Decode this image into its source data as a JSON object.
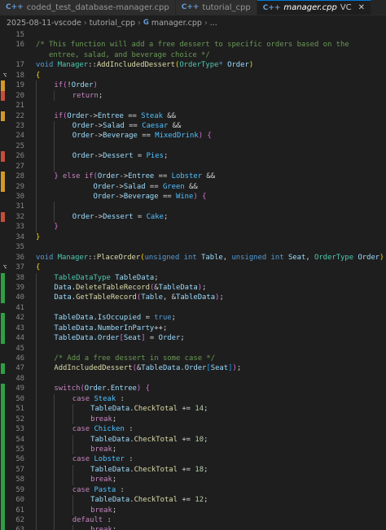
{
  "tabs": [
    {
      "label": "coded_test_database-manager.cpp",
      "icon": "C++",
      "active": false
    },
    {
      "label": "tutorial_cpp",
      "icon": "C++",
      "active": false
    },
    {
      "label": "manager.cpp",
      "icon": "C++",
      "active": true,
      "suffix": "VC"
    }
  ],
  "breadcrumb": [
    "2025-08-11-vscode",
    "tutorial_cpp",
    "manager.cpp",
    "..."
  ],
  "colors": {
    "added": "#2ea043",
    "modified": "#d19a2a",
    "deleted": "#c74e39"
  },
  "lines": [
    {
      "n": "15",
      "m": "",
      "t": [
        [
          "pl",
          ""
        ]
      ]
    },
    {
      "n": "16",
      "m": "",
      "t": [
        [
          "cm",
          "/* This function will add a free dessert to specific orders based on the"
        ]
      ]
    },
    {
      "n": "",
      "m": "",
      "t": [
        [
          "cm",
          "   entree, salad, and beverage choice */"
        ]
      ]
    },
    {
      "n": "17",
      "m": "",
      "t": [
        [
          "kw",
          "void "
        ],
        [
          "ty",
          "Manager"
        ],
        [
          "pl",
          "::"
        ],
        [
          "fn",
          "AddIncludedDessert"
        ],
        [
          "b1",
          "("
        ],
        [
          "ty",
          "OrderType"
        ],
        [
          "kw",
          "*"
        ],
        [
          "var",
          " Order"
        ],
        [
          "b1",
          ")"
        ]
      ]
    },
    {
      "n": "18",
      "m": "",
      "g": "ref",
      "t": [
        [
          "b1",
          "{"
        ]
      ]
    },
    {
      "n": "19",
      "m": "orange",
      "t": [
        [
          "i",
          ""
        ],
        [
          "ctl",
          "if"
        ],
        [
          "b2",
          "("
        ],
        [
          "pl",
          "!"
        ],
        [
          "var",
          "Order"
        ],
        [
          "b2",
          ")"
        ]
      ]
    },
    {
      "n": "20",
      "m": "red",
      "t": [
        [
          "i",
          ""
        ],
        [
          "i",
          ""
        ],
        [
          "ctl",
          "return"
        ],
        [
          "pl",
          ";"
        ]
      ]
    },
    {
      "n": "21",
      "m": "",
      "t": [
        [
          "i",
          ""
        ]
      ]
    },
    {
      "n": "22",
      "m": "orange",
      "t": [
        [
          "i",
          ""
        ],
        [
          "ctl",
          "if"
        ],
        [
          "b2",
          "("
        ],
        [
          "var",
          "Order"
        ],
        [
          "pl",
          "->"
        ],
        [
          "var",
          "Entree"
        ],
        [
          "pl",
          " == "
        ],
        [
          "en",
          "Steak"
        ],
        [
          "pl",
          " &&"
        ]
      ]
    },
    {
      "n": "23",
      "m": "",
      "t": [
        [
          "i",
          ""
        ],
        [
          "i",
          ""
        ],
        [
          "var",
          "Order"
        ],
        [
          "pl",
          "->"
        ],
        [
          "var",
          "Salad"
        ],
        [
          "pl",
          " == "
        ],
        [
          "en",
          "Caesar"
        ],
        [
          "pl",
          " &&"
        ]
      ]
    },
    {
      "n": "24",
      "m": "",
      "t": [
        [
          "i",
          ""
        ],
        [
          "i",
          ""
        ],
        [
          "var",
          "Order"
        ],
        [
          "pl",
          "->"
        ],
        [
          "var",
          "Beverage"
        ],
        [
          "pl",
          " == "
        ],
        [
          "en",
          "MixedDrink"
        ],
        [
          "b2",
          ")"
        ],
        [
          "pl",
          " "
        ],
        [
          "b2",
          "{"
        ]
      ]
    },
    {
      "n": "25",
      "m": "",
      "t": [
        [
          "i",
          ""
        ],
        [
          "i",
          ""
        ]
      ]
    },
    {
      "n": "26",
      "m": "red",
      "t": [
        [
          "i",
          ""
        ],
        [
          "i",
          ""
        ],
        [
          "var",
          "Order"
        ],
        [
          "pl",
          "->"
        ],
        [
          "var",
          "Dessert"
        ],
        [
          "pl",
          " = "
        ],
        [
          "en",
          "Pies"
        ],
        [
          "pl",
          ";"
        ]
      ]
    },
    {
      "n": "27",
      "m": "",
      "t": [
        [
          "i",
          ""
        ],
        [
          "i",
          ""
        ]
      ]
    },
    {
      "n": "28",
      "m": "orange",
      "t": [
        [
          "i",
          ""
        ],
        [
          "b2",
          "}"
        ],
        [
          "ctl",
          " else if"
        ],
        [
          "b2",
          "("
        ],
        [
          "var",
          "Order"
        ],
        [
          "pl",
          "->"
        ],
        [
          "var",
          "Entree"
        ],
        [
          "pl",
          " == "
        ],
        [
          "en",
          "Lobster"
        ],
        [
          "pl",
          " &&"
        ]
      ]
    },
    {
      "n": "29",
      "m": "orange",
      "t": [
        [
          "i",
          ""
        ],
        [
          "pl",
          "         "
        ],
        [
          "var",
          "Order"
        ],
        [
          "pl",
          "->"
        ],
        [
          "var",
          "Salad"
        ],
        [
          "pl",
          " == "
        ],
        [
          "en",
          "Green"
        ],
        [
          "pl",
          " &&"
        ]
      ]
    },
    {
      "n": "30",
      "m": "",
      "t": [
        [
          "i",
          ""
        ],
        [
          "pl",
          "         "
        ],
        [
          "var",
          "Order"
        ],
        [
          "pl",
          "->"
        ],
        [
          "var",
          "Beverage"
        ],
        [
          "pl",
          " == "
        ],
        [
          "en",
          "Wine"
        ],
        [
          "b2",
          ")"
        ],
        [
          "pl",
          " "
        ],
        [
          "b2",
          "{"
        ]
      ]
    },
    {
      "n": "31",
      "m": "",
      "t": [
        [
          "i",
          ""
        ],
        [
          "i",
          ""
        ]
      ]
    },
    {
      "n": "32",
      "m": "red",
      "t": [
        [
          "i",
          ""
        ],
        [
          "i",
          ""
        ],
        [
          "var",
          "Order"
        ],
        [
          "pl",
          "->"
        ],
        [
          "var",
          "Dessert"
        ],
        [
          "pl",
          " = "
        ],
        [
          "en",
          "Cake"
        ],
        [
          "pl",
          ";"
        ]
      ]
    },
    {
      "n": "33",
      "m": "",
      "t": [
        [
          "i",
          ""
        ],
        [
          "b2",
          "}"
        ]
      ]
    },
    {
      "n": "34",
      "m": "",
      "t": [
        [
          "b1",
          "}"
        ]
      ]
    },
    {
      "n": "35",
      "m": "",
      "t": [
        [
          "pl",
          ""
        ]
      ]
    },
    {
      "n": "36",
      "m": "",
      "t": [
        [
          "kw",
          "void "
        ],
        [
          "ty",
          "Manager"
        ],
        [
          "pl",
          "::"
        ],
        [
          "fn",
          "PlaceOrder"
        ],
        [
          "b1",
          "("
        ],
        [
          "kw",
          "unsigned int "
        ],
        [
          "var",
          "Table"
        ],
        [
          "pl",
          ", "
        ],
        [
          "kw",
          "unsigned int "
        ],
        [
          "var",
          "Seat"
        ],
        [
          "pl",
          ", "
        ],
        [
          "ty",
          "OrderType "
        ],
        [
          "var",
          "Order"
        ],
        [
          "b1",
          ")"
        ]
      ]
    },
    {
      "n": "37",
      "m": "",
      "g": "ref",
      "t": [
        [
          "b1",
          "{"
        ]
      ]
    },
    {
      "n": "38",
      "m": "green",
      "t": [
        [
          "i",
          ""
        ],
        [
          "ty",
          "TableDataType "
        ],
        [
          "var",
          "TableData"
        ],
        [
          "pl",
          ";"
        ]
      ]
    },
    {
      "n": "39",
      "m": "green",
      "t": [
        [
          "i",
          ""
        ],
        [
          "var",
          "Data"
        ],
        [
          "pl",
          "."
        ],
        [
          "fn",
          "DeleteTableRecord"
        ],
        [
          "b2",
          "("
        ],
        [
          "pl",
          "&"
        ],
        [
          "var",
          "TableData"
        ],
        [
          "b2",
          ")"
        ],
        [
          "pl",
          ";"
        ]
      ]
    },
    {
      "n": "40",
      "m": "green",
      "t": [
        [
          "i",
          ""
        ],
        [
          "var",
          "Data"
        ],
        [
          "pl",
          "."
        ],
        [
          "fn",
          "GetTableRecord"
        ],
        [
          "b2",
          "("
        ],
        [
          "var",
          "Table"
        ],
        [
          "pl",
          ", &"
        ],
        [
          "var",
          "TableData"
        ],
        [
          "b2",
          ")"
        ],
        [
          "pl",
          ";"
        ]
      ]
    },
    {
      "n": "41",
      "m": "",
      "t": [
        [
          "i",
          ""
        ]
      ]
    },
    {
      "n": "42",
      "m": "green",
      "t": [
        [
          "i",
          ""
        ],
        [
          "var",
          "TableData"
        ],
        [
          "pl",
          "."
        ],
        [
          "var",
          "IsOccupied"
        ],
        [
          "pl",
          " = "
        ],
        [
          "kw",
          "true"
        ],
        [
          "pl",
          ";"
        ]
      ]
    },
    {
      "n": "43",
      "m": "green",
      "t": [
        [
          "i",
          ""
        ],
        [
          "var",
          "TableData"
        ],
        [
          "pl",
          "."
        ],
        [
          "var",
          "NumberInParty"
        ],
        [
          "pl",
          "++;"
        ]
      ]
    },
    {
      "n": "44",
      "m": "green",
      "t": [
        [
          "i",
          ""
        ],
        [
          "var",
          "TableData"
        ],
        [
          "pl",
          "."
        ],
        [
          "var",
          "Order"
        ],
        [
          "b2",
          "["
        ],
        [
          "var",
          "Seat"
        ],
        [
          "b2",
          "]"
        ],
        [
          "pl",
          " = "
        ],
        [
          "var",
          "Order"
        ],
        [
          "pl",
          ";"
        ]
      ]
    },
    {
      "n": "45",
      "m": "",
      "t": [
        [
          "i",
          ""
        ]
      ]
    },
    {
      "n": "46",
      "m": "",
      "t": [
        [
          "i",
          ""
        ],
        [
          "cm",
          "/* Add a free dessert in some case */"
        ]
      ]
    },
    {
      "n": "47",
      "m": "green",
      "t": [
        [
          "i",
          ""
        ],
        [
          "fn",
          "AddIncludedDessert"
        ],
        [
          "b2",
          "("
        ],
        [
          "pl",
          "&"
        ],
        [
          "var",
          "TableData"
        ],
        [
          "pl",
          "."
        ],
        [
          "var",
          "Order"
        ],
        [
          "b3",
          "["
        ],
        [
          "var",
          "Seat"
        ],
        [
          "b3",
          "]"
        ],
        [
          "b2",
          ")"
        ],
        [
          "pl",
          ";"
        ]
      ]
    },
    {
      "n": "48",
      "m": "",
      "t": [
        [
          "i",
          ""
        ]
      ]
    },
    {
      "n": "49",
      "m": "green",
      "t": [
        [
          "i",
          ""
        ],
        [
          "ctl",
          "switch"
        ],
        [
          "b2",
          "("
        ],
        [
          "var",
          "Order"
        ],
        [
          "pl",
          "."
        ],
        [
          "var",
          "Entree"
        ],
        [
          "b2",
          ")"
        ],
        [
          "pl",
          " "
        ],
        [
          "b2",
          "{"
        ]
      ]
    },
    {
      "n": "50",
      "m": "green",
      "t": [
        [
          "i",
          ""
        ],
        [
          "i",
          ""
        ],
        [
          "ctl",
          "case "
        ],
        [
          "en",
          "Steak"
        ],
        [
          "pl",
          " :"
        ]
      ]
    },
    {
      "n": "51",
      "m": "green",
      "t": [
        [
          "i",
          ""
        ],
        [
          "i",
          ""
        ],
        [
          "i",
          ""
        ],
        [
          "var",
          "TableData"
        ],
        [
          "pl",
          "."
        ],
        [
          "fn",
          "CheckTotal"
        ],
        [
          "pl",
          " += "
        ],
        [
          "num-lit",
          "14"
        ],
        [
          "pl",
          ";"
        ]
      ]
    },
    {
      "n": "52",
      "m": "green",
      "t": [
        [
          "i",
          ""
        ],
        [
          "i",
          ""
        ],
        [
          "i",
          ""
        ],
        [
          "ctl",
          "break"
        ],
        [
          "pl",
          ";"
        ]
      ]
    },
    {
      "n": "53",
      "m": "green",
      "t": [
        [
          "i",
          ""
        ],
        [
          "i",
          ""
        ],
        [
          "ctl",
          "case "
        ],
        [
          "en",
          "Chicken"
        ],
        [
          "pl",
          " :"
        ]
      ]
    },
    {
      "n": "54",
      "m": "green",
      "t": [
        [
          "i",
          ""
        ],
        [
          "i",
          ""
        ],
        [
          "i",
          ""
        ],
        [
          "var",
          "TableData"
        ],
        [
          "pl",
          "."
        ],
        [
          "fn",
          "CheckTotal"
        ],
        [
          "pl",
          " += "
        ],
        [
          "num-lit",
          "10"
        ],
        [
          "pl",
          ";"
        ]
      ]
    },
    {
      "n": "55",
      "m": "green",
      "t": [
        [
          "i",
          ""
        ],
        [
          "i",
          ""
        ],
        [
          "i",
          ""
        ],
        [
          "ctl",
          "break"
        ],
        [
          "pl",
          ";"
        ]
      ]
    },
    {
      "n": "56",
      "m": "green",
      "t": [
        [
          "i",
          ""
        ],
        [
          "i",
          ""
        ],
        [
          "ctl",
          "case "
        ],
        [
          "en",
          "Lobster"
        ],
        [
          "pl",
          " :"
        ]
      ]
    },
    {
      "n": "57",
      "m": "green",
      "t": [
        [
          "i",
          ""
        ],
        [
          "i",
          ""
        ],
        [
          "i",
          ""
        ],
        [
          "var",
          "TableData"
        ],
        [
          "pl",
          "."
        ],
        [
          "fn",
          "CheckTotal"
        ],
        [
          "pl",
          " += "
        ],
        [
          "num-lit",
          "18"
        ],
        [
          "pl",
          ";"
        ]
      ]
    },
    {
      "n": "58",
      "m": "green",
      "t": [
        [
          "i",
          ""
        ],
        [
          "i",
          ""
        ],
        [
          "i",
          ""
        ],
        [
          "ctl",
          "break"
        ],
        [
          "pl",
          ";"
        ]
      ]
    },
    {
      "n": "59",
      "m": "green",
      "t": [
        [
          "i",
          ""
        ],
        [
          "i",
          ""
        ],
        [
          "ctl",
          "case "
        ],
        [
          "en",
          "Pasta"
        ],
        [
          "pl",
          " :"
        ]
      ]
    },
    {
      "n": "60",
      "m": "green",
      "t": [
        [
          "i",
          ""
        ],
        [
          "i",
          ""
        ],
        [
          "i",
          ""
        ],
        [
          "var",
          "TableData"
        ],
        [
          "pl",
          "."
        ],
        [
          "fn",
          "CheckTotal"
        ],
        [
          "pl",
          " += "
        ],
        [
          "num-lit",
          "12"
        ],
        [
          "pl",
          ";"
        ]
      ]
    },
    {
      "n": "61",
      "m": "green",
      "t": [
        [
          "i",
          ""
        ],
        [
          "i",
          ""
        ],
        [
          "i",
          ""
        ],
        [
          "ctl",
          "break"
        ],
        [
          "pl",
          ";"
        ]
      ]
    },
    {
      "n": "62",
      "m": "green",
      "t": [
        [
          "i",
          ""
        ],
        [
          "i",
          ""
        ],
        [
          "ctl",
          "default"
        ],
        [
          "pl",
          " :"
        ]
      ]
    },
    {
      "n": "63",
      "m": "green",
      "t": [
        [
          "i",
          ""
        ],
        [
          "i",
          ""
        ],
        [
          "i",
          ""
        ],
        [
          "ctl",
          "break"
        ],
        [
          "pl",
          ";"
        ]
      ]
    }
  ]
}
